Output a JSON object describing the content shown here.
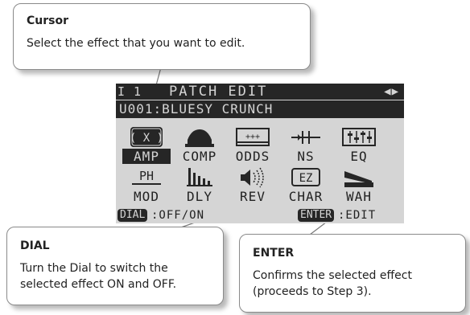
{
  "callouts": {
    "cursor": {
      "title": "Cursor",
      "body": "Select the effect that you want to edit."
    },
    "dial": {
      "title": "DIAL",
      "body": "Turn the Dial to switch the selected effect ON and OFF."
    },
    "enter": {
      "title": "ENTER",
      "body": "Confirms the selected effect (proceeds to Step 3)."
    }
  },
  "lcd": {
    "indicator": "I 1",
    "title": "PATCH EDIT",
    "arrows": "◀▶",
    "patch": "U001:BLUESY CRUNCH",
    "effects_row1": [
      {
        "label": "AMP",
        "icon": "amp-icon"
      },
      {
        "label": "COMP",
        "icon": "comp-icon"
      },
      {
        "label": "ODDS",
        "icon": "odds-icon"
      },
      {
        "label": "NS",
        "icon": "noise-suppressor-icon"
      },
      {
        "label": "EQ",
        "icon": "eq-icon"
      }
    ],
    "effects_row2": [
      {
        "label": "MOD",
        "icon": "mod-icon",
        "glyph_text": "PH"
      },
      {
        "label": "DLY",
        "icon": "delay-icon"
      },
      {
        "label": "REV",
        "icon": "reverb-icon"
      },
      {
        "label": "CHAR",
        "icon": "char-icon",
        "glyph_text": "EZ"
      },
      {
        "label": "WAH",
        "icon": "wah-icon"
      }
    ],
    "footer": {
      "dial_label": "DIAL",
      "dial_action": ":OFF/ON",
      "enter_label": "ENTER",
      "enter_action": ":EDIT"
    }
  }
}
